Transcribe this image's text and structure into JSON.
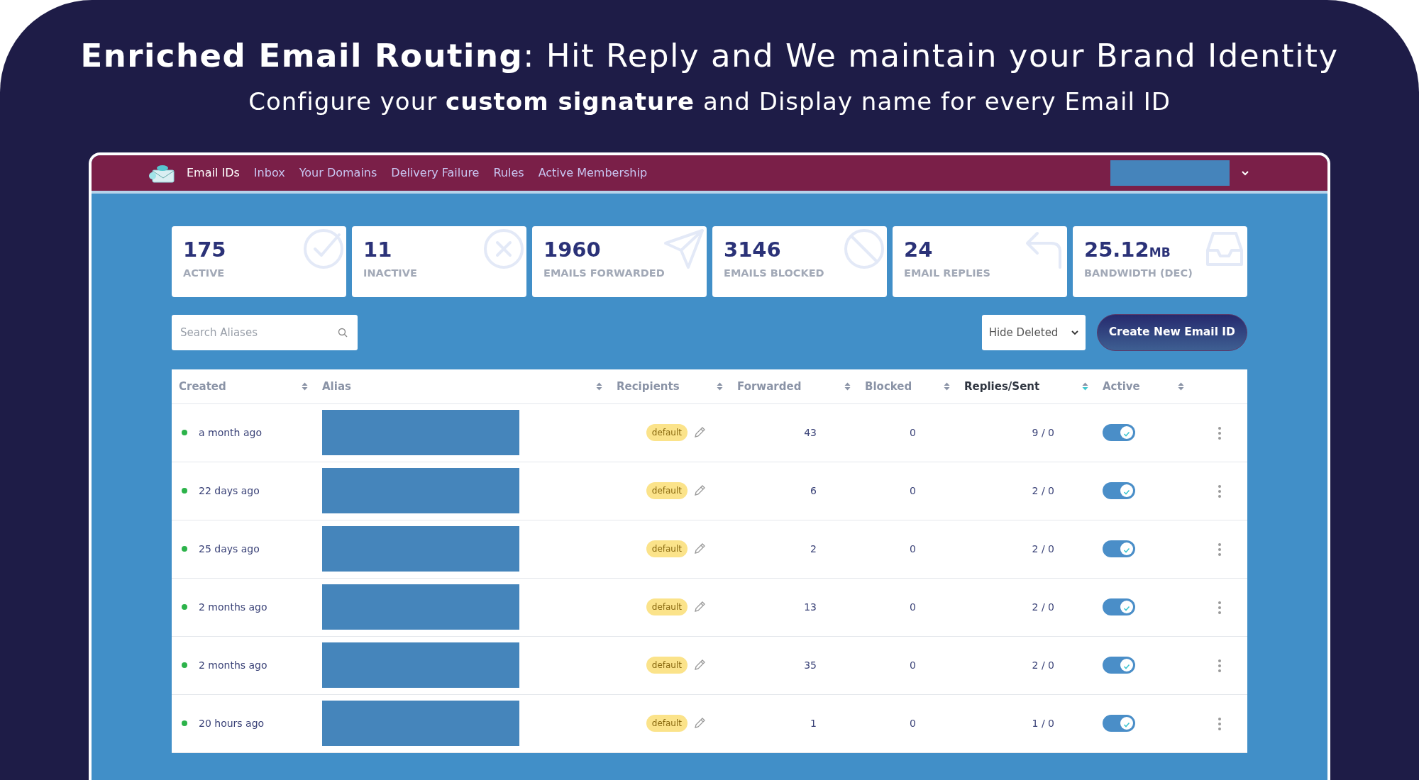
{
  "headline": "**Enriched Email Routing**: Hit Reply and We maintain your Brand Identity",
  "subheadline": "Configure your **custom signature** and Display name for every Email ID",
  "navbar": {
    "items": [
      {
        "label": "Email IDs",
        "selected": true
      },
      {
        "label": "Inbox",
        "selected": false
      },
      {
        "label": "Your Domains",
        "selected": false
      },
      {
        "label": "Delivery Failure",
        "selected": false
      },
      {
        "label": "Rules",
        "selected": false
      },
      {
        "label": "Active Membership",
        "selected": false
      }
    ]
  },
  "stats": [
    {
      "kind": "check",
      "value": "175",
      "label": "ACTIVE"
    },
    {
      "kind": "cross",
      "value": "11",
      "label": "INACTIVE"
    },
    {
      "kind": "send",
      "value": "1960",
      "label": "EMAILS FORWARDED"
    },
    {
      "kind": "blocked",
      "value": "3146",
      "label": "EMAILS BLOCKED"
    },
    {
      "kind": "reply",
      "value": "24",
      "label": "EMAIL REPLIES"
    },
    {
      "kind": "inbox",
      "value": "25.12",
      "unit": "MB",
      "label": "BANDWIDTH (DEC)"
    }
  ],
  "search": {
    "placeholder": "Search Aliases"
  },
  "filter": {
    "value": "Hide Deleted"
  },
  "create_button": "Create New Email ID",
  "table": {
    "columns": [
      {
        "label": "Created",
        "sorted": false
      },
      {
        "label": "Alias",
        "sorted": false
      },
      {
        "label": "Recipients",
        "sorted": false
      },
      {
        "label": "Forwarded",
        "sorted": false
      },
      {
        "label": "Blocked",
        "sorted": false
      },
      {
        "label": "Replies/Sent",
        "sorted": true
      },
      {
        "label": "Active",
        "sorted": false
      }
    ],
    "rows": [
      {
        "created": "a month ago",
        "recipients": "default",
        "forwarded": "43",
        "blocked": "0",
        "replies_sent": "9 / 0",
        "active": true
      },
      {
        "created": "22 days ago",
        "recipients": "default",
        "forwarded": "6",
        "blocked": "0",
        "replies_sent": "2 / 0",
        "active": true
      },
      {
        "created": "25 days ago",
        "recipients": "default",
        "forwarded": "2",
        "blocked": "0",
        "replies_sent": "2 / 0",
        "active": true
      },
      {
        "created": "2 months ago",
        "recipients": "default",
        "forwarded": "13",
        "blocked": "0",
        "replies_sent": "2 / 0",
        "active": true
      },
      {
        "created": "2 months ago",
        "recipients": "default",
        "forwarded": "35",
        "blocked": "0",
        "replies_sent": "2 / 0",
        "active": true
      },
      {
        "created": "20 hours ago",
        "recipients": "default",
        "forwarded": "1",
        "blocked": "0",
        "replies_sent": "1 / 0",
        "active": true
      }
    ]
  }
}
